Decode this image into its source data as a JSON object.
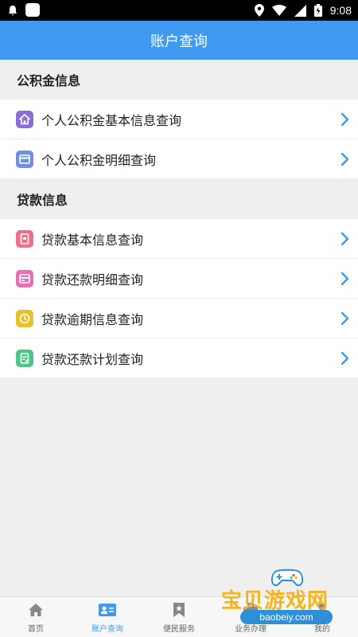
{
  "status_bar": {
    "time": "9:08"
  },
  "title": "账户查询",
  "sections": [
    {
      "title": "公积金信息",
      "items": [
        {
          "label": "个人公积金基本信息查询",
          "icon": "home-icon",
          "color": "#8b6fd8"
        },
        {
          "label": "个人公积金明细查询",
          "icon": "card-icon",
          "color": "#6f8fe0"
        }
      ]
    },
    {
      "title": "贷款信息",
      "items": [
        {
          "label": "贷款基本信息查询",
          "icon": "document-icon",
          "color": "#ee6f8c"
        },
        {
          "label": "贷款还款明细查询",
          "icon": "card-icon",
          "color": "#e66fb6"
        },
        {
          "label": "贷款逾期信息查询",
          "icon": "clock-icon",
          "color": "#e8c12a"
        },
        {
          "label": "贷款还款计划查询",
          "icon": "plan-icon",
          "color": "#4dc585"
        }
      ]
    }
  ],
  "tabs": [
    {
      "label": "首页",
      "icon": "home-icon",
      "active": false
    },
    {
      "label": "账户查询",
      "icon": "id-card-icon",
      "active": true
    },
    {
      "label": "便民服务",
      "icon": "bookmark-icon",
      "active": false
    },
    {
      "label": "业务办理",
      "icon": "briefcase-icon",
      "active": false
    },
    {
      "label": "我的",
      "icon": "person-icon",
      "active": false
    }
  ],
  "watermark": {
    "text": "宝贝游戏网",
    "url": "baobeiy.com"
  },
  "colors": {
    "primary": "#3f9af0",
    "chevron": "#3f9af0"
  }
}
